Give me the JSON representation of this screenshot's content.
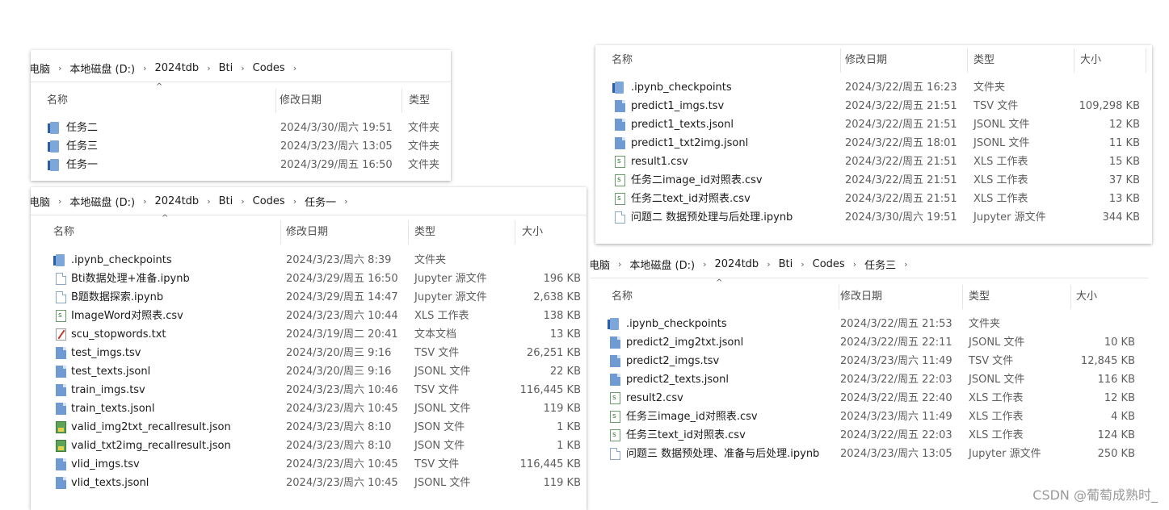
{
  "panel1": {
    "breadcrumb": [
      "电脑",
      "本地磁盘 (D:)",
      "2024tdb",
      "Bti",
      "Codes"
    ],
    "columns": {
      "name": "名称",
      "date": "修改日期",
      "type": "类型"
    },
    "rows": [
      {
        "icon": "folder",
        "name": "任务二",
        "date": "2024/3/30/周六 19:51",
        "type": "文件夹",
        "size": ""
      },
      {
        "icon": "folder",
        "name": "任务三",
        "date": "2024/3/23/周六 13:05",
        "type": "文件夹",
        "size": ""
      },
      {
        "icon": "folder",
        "name": "任务一",
        "date": "2024/3/29/周五 16:50",
        "type": "文件夹",
        "size": ""
      }
    ]
  },
  "panel2": {
    "breadcrumb": [
      "电脑",
      "本地磁盘 (D:)",
      "2024tdb",
      "Bti",
      "Codes",
      "任务一"
    ],
    "columns": {
      "name": "名称",
      "date": "修改日期",
      "type": "类型",
      "size": "大小"
    },
    "rows": [
      {
        "icon": "folder",
        "name": ".ipynb_checkpoints",
        "date": "2024/3/23/周六 8:39",
        "type": "文件夹",
        "size": ""
      },
      {
        "icon": "file",
        "name": "Bti数据处理+准备.ipynb",
        "date": "2024/3/29/周五 16:50",
        "type": "Jupyter 源文件",
        "size": "196 KB"
      },
      {
        "icon": "file",
        "name": "B题数据探索.ipynb",
        "date": "2024/3/29/周五 14:47",
        "type": "Jupyter 源文件",
        "size": "2,638 KB"
      },
      {
        "icon": "xls",
        "name": "ImageWord对照表.csv",
        "date": "2024/3/23/周六 10:44",
        "type": "XLS 工作表",
        "size": "138 KB"
      },
      {
        "icon": "red",
        "name": "scu_stopwords.txt",
        "date": "2024/3/19/周二 20:41",
        "type": "文本文档",
        "size": "13 KB"
      },
      {
        "icon": "blue",
        "name": "test_imgs.tsv",
        "date": "2024/3/20/周三 9:16",
        "type": "TSV 文件",
        "size": "26,251 KB"
      },
      {
        "icon": "blue",
        "name": "test_texts.jsonl",
        "date": "2024/3/20/周三 9:16",
        "type": "JSONL 文件",
        "size": "22 KB"
      },
      {
        "icon": "blue",
        "name": "train_imgs.tsv",
        "date": "2024/3/23/周六 10:46",
        "type": "TSV 文件",
        "size": "116,445 KB"
      },
      {
        "icon": "blue",
        "name": "train_texts.jsonl",
        "date": "2024/3/23/周六 10:45",
        "type": "JSONL 文件",
        "size": "119 KB"
      },
      {
        "icon": "json",
        "name": "valid_img2txt_recallresult.json",
        "date": "2024/3/23/周六 8:10",
        "type": "JSON 文件",
        "size": "1 KB"
      },
      {
        "icon": "json",
        "name": "valid_txt2img_recallresult.json",
        "date": "2024/3/23/周六 8:10",
        "type": "JSON 文件",
        "size": "1 KB"
      },
      {
        "icon": "blue",
        "name": "vlid_imgs.tsv",
        "date": "2024/3/23/周六 10:45",
        "type": "TSV 文件",
        "size": "116,445 KB"
      },
      {
        "icon": "blue",
        "name": "vlid_texts.jsonl",
        "date": "2024/3/23/周六 10:45",
        "type": "JSONL 文件",
        "size": "119 KB"
      }
    ]
  },
  "panel3": {
    "columns": {
      "name": "名称",
      "date": "修改日期",
      "type": "类型",
      "size": "大小"
    },
    "rows": [
      {
        "icon": "folder",
        "name": ".ipynb_checkpoints",
        "date": "2024/3/22/周五 16:23",
        "type": "文件夹",
        "size": ""
      },
      {
        "icon": "blue",
        "name": "predict1_imgs.tsv",
        "date": "2024/3/22/周五 21:51",
        "type": "TSV 文件",
        "size": "109,298 KB"
      },
      {
        "icon": "blue",
        "name": "predict1_texts.jsonl",
        "date": "2024/3/22/周五 21:51",
        "type": "JSONL 文件",
        "size": "12 KB"
      },
      {
        "icon": "blue",
        "name": "predict1_txt2img.jsonl",
        "date": "2024/3/22/周五 18:01",
        "type": "JSONL 文件",
        "size": "11 KB"
      },
      {
        "icon": "xls",
        "name": "result1.csv",
        "date": "2024/3/22/周五 21:51",
        "type": "XLS 工作表",
        "size": "15 KB"
      },
      {
        "icon": "xls",
        "name": "任务二image_id对照表.csv",
        "date": "2024/3/22/周五 21:51",
        "type": "XLS 工作表",
        "size": "37 KB"
      },
      {
        "icon": "xls",
        "name": "任务二text_id对照表.csv",
        "date": "2024/3/22/周五 21:51",
        "type": "XLS 工作表",
        "size": "13 KB"
      },
      {
        "icon": "file",
        "name": "问题二 数据预处理与后处理.ipynb",
        "date": "2024/3/30/周六 19:51",
        "type": "Jupyter 源文件",
        "size": "344 KB"
      }
    ]
  },
  "panel4": {
    "breadcrumb": [
      "电脑",
      "本地磁盘 (D:)",
      "2024tdb",
      "Bti",
      "Codes",
      "任务三"
    ],
    "columns": {
      "name": "名称",
      "date": "修改日期",
      "type": "类型",
      "size": "大小"
    },
    "rows": [
      {
        "icon": "folder",
        "name": ".ipynb_checkpoints",
        "date": "2024/3/22/周五 21:53",
        "type": "文件夹",
        "size": ""
      },
      {
        "icon": "blue",
        "name": "predict2_img2txt.jsonl",
        "date": "2024/3/22/周五 22:11",
        "type": "JSONL 文件",
        "size": "10 KB"
      },
      {
        "icon": "blue",
        "name": "predict2_imgs.tsv",
        "date": "2024/3/23/周六 11:49",
        "type": "TSV 文件",
        "size": "12,845 KB"
      },
      {
        "icon": "blue",
        "name": "predict2_texts.jsonl",
        "date": "2024/3/22/周五 22:03",
        "type": "JSONL 文件",
        "size": "116 KB"
      },
      {
        "icon": "xls",
        "name": "result2.csv",
        "date": "2024/3/22/周五 22:40",
        "type": "XLS 工作表",
        "size": "12 KB"
      },
      {
        "icon": "xls",
        "name": "任务三image_id对照表.csv",
        "date": "2024/3/23/周六 11:49",
        "type": "XLS 工作表",
        "size": "4 KB"
      },
      {
        "icon": "xls",
        "name": "任务三text_id对照表.csv",
        "date": "2024/3/22/周五 22:03",
        "type": "XLS 工作表",
        "size": "124 KB"
      },
      {
        "icon": "file",
        "name": "问题三 数据预处理、准备与后处理.ipynb",
        "date": "2024/3/23/周六 13:05",
        "type": "Jupyter 源文件",
        "size": "250 KB"
      }
    ]
  },
  "watermark": "CSDN @葡萄成熟时_"
}
